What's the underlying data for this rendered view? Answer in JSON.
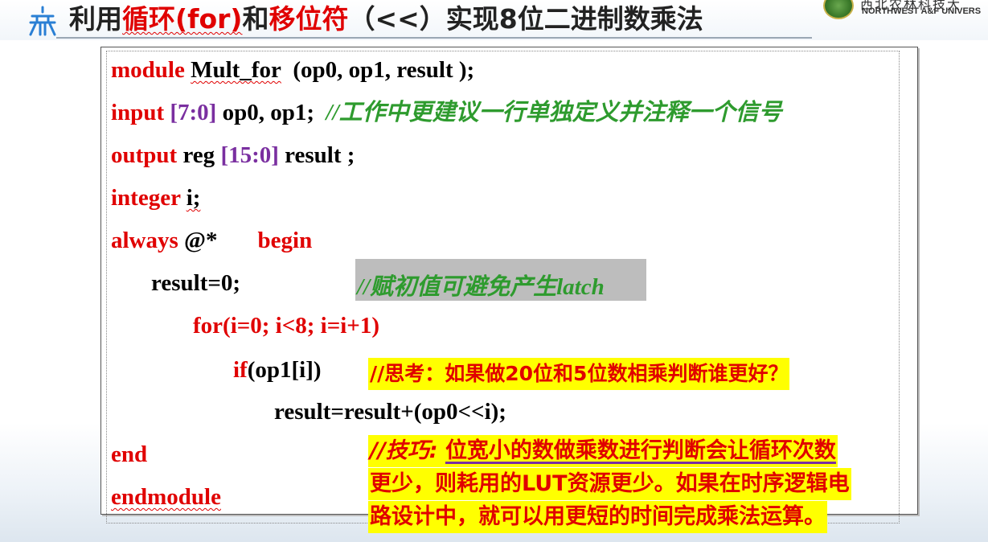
{
  "title": {
    "part1": "利用",
    "part2": "循环(for)",
    "part3": "和",
    "part4": "移位符",
    "part5": "（<<）实现8位二进制数乘法"
  },
  "university": {
    "name_cn": "西北农林科技大",
    "name_en": "NORTHWEST A&F UNIVERS"
  },
  "code": {
    "l1_kw": "module",
    "l1_name": "Mult_for",
    "l1_rest": "(op0, op1, result );",
    "l2_kw": "input",
    "l2_range": "[7:0]",
    "l2_rest": "op0, op1;",
    "l2_comment": "//工作中更建议一行单独定义并注释一个信号",
    "l3_kw": "output",
    "l3_mid": "reg",
    "l3_range": "[15:0]",
    "l3_rest": "result ;",
    "l4_kw": "integer",
    "l4_rest": "i;",
    "l5_kw": "always",
    "l5_at": "@*",
    "l5_begin": "begin",
    "l6_text": "result=0;",
    "l6_comment": "//赋初值可避免产生latch",
    "l7_kw": "for",
    "l7_rest": "(i=0; i<8; i=i+1)",
    "l8_kw": "if",
    "l8_rest": "(op1[i])",
    "l9_text": "result=result+(op0<<i);",
    "l10_kw": "end",
    "l11_kw": "endmodule"
  },
  "notes": {
    "think": "//思考：如果做20位和5位数相乘判断谁更好？",
    "tip_prefix": "//技巧:",
    "tip_line1": "位宽小的数做乘数进行判断会让循环次数",
    "tip_line2": "更少，则耗用的LUT资源更少。如果在时序逻辑电",
    "tip_line3": "路设计中，就可以用更短的时间完成乘法运算。"
  },
  "colors": {
    "keyword": "#e00000",
    "range": "#7a2fa0",
    "comment": "#2e9b2e",
    "highlight": "#ffff00"
  }
}
